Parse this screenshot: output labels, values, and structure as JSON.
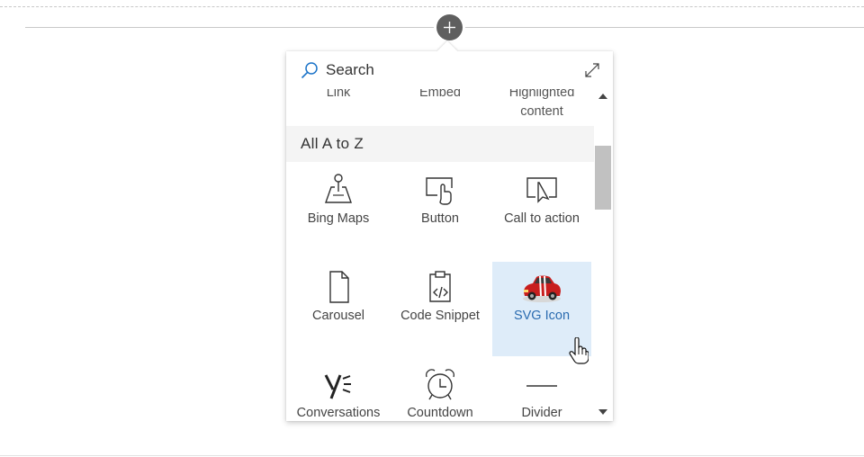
{
  "toolbox": {
    "search_placeholder": "Search",
    "top_row": [
      {
        "label": "Link"
      },
      {
        "label": "Embed"
      },
      {
        "label": "Highlighted content"
      }
    ],
    "category": "All A to Z",
    "tiles": [
      {
        "label": "Bing Maps",
        "icon": "bing-maps-icon"
      },
      {
        "label": "Button",
        "icon": "button-icon"
      },
      {
        "label": "Call to action",
        "icon": "call-to-action-icon"
      },
      {
        "label": "Carousel",
        "icon": "carousel-icon"
      },
      {
        "label": "Code Snippet",
        "icon": "code-snippet-icon"
      },
      {
        "label": "SVG Icon",
        "icon": "red-car-icon",
        "selected": true
      },
      {
        "label": "Conversations",
        "icon": "yammer-icon"
      },
      {
        "label": "Countdown",
        "icon": "alarm-clock-icon"
      },
      {
        "label": "Divider",
        "icon": "divider-icon"
      }
    ]
  },
  "colors": {
    "selected_tile_bg": "#deecf9",
    "selected_label": "#2b6cb0",
    "search_icon": "#1a73c8",
    "add_button": "#5f5f5f"
  }
}
